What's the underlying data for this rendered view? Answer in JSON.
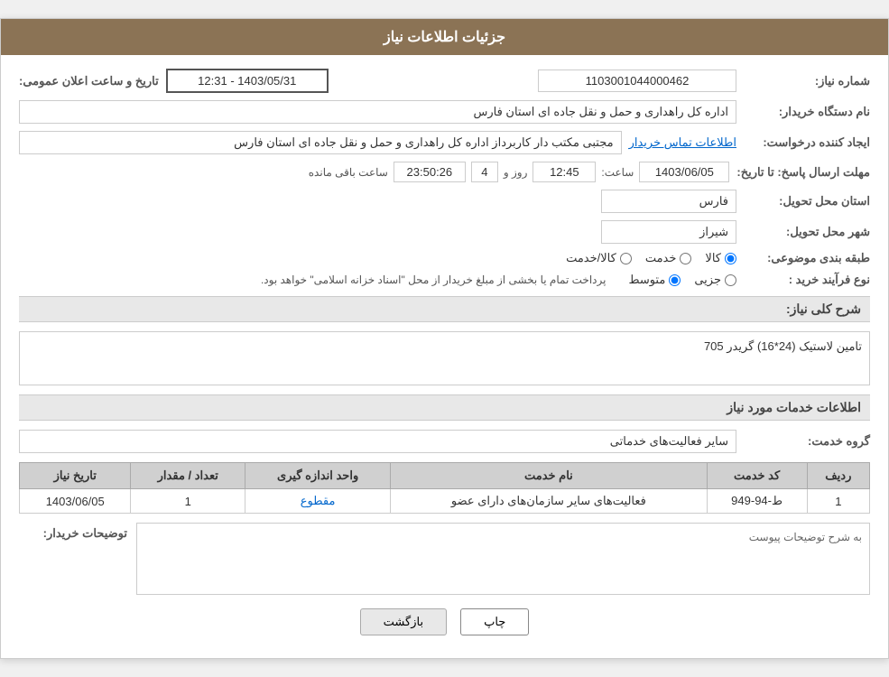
{
  "header": {
    "title": "جزئیات اطلاعات نیاز"
  },
  "form": {
    "need_number_label": "شماره نیاز:",
    "need_number_value": "1103001044000462",
    "purchaser_org_label": "نام دستگاه خریدار:",
    "purchaser_org_value": "اداره کل راهداری و حمل و نقل جاده ای استان فارس",
    "creator_label": "ایجاد کننده درخواست:",
    "creator_value": "مجتبی مکتب دار کاربرداز اداره کل راهداری و حمل و نقل جاده ای استان فارس",
    "contact_info_label": "اطلاعات تماس خریدار",
    "send_deadline_label": "مهلت ارسال پاسخ: تا تاریخ:",
    "send_deadline_date": "1403/06/05",
    "send_deadline_time_label": "ساعت:",
    "send_deadline_time": "12:45",
    "send_deadline_days_label": "روز و",
    "send_deadline_days": "4",
    "send_deadline_remaining_label": "ساعت باقی مانده",
    "send_deadline_remaining": "23:50:26",
    "province_label": "استان محل تحویل:",
    "province_value": "فارس",
    "city_label": "شهر محل تحویل:",
    "city_value": "شیراز",
    "category_label": "طبقه بندی موضوعی:",
    "category_options": [
      {
        "id": "kala",
        "label": "کالا"
      },
      {
        "id": "khadamat",
        "label": "خدمت"
      },
      {
        "id": "kala_khadamat",
        "label": "کالا/خدمت"
      }
    ],
    "category_selected": "kala",
    "purchase_type_label": "نوع فرآیند خرید :",
    "purchase_type_options": [
      {
        "id": "jozei",
        "label": "جزیی"
      },
      {
        "id": "motavaset",
        "label": "متوسط"
      }
    ],
    "purchase_type_selected": "motavaset",
    "purchase_type_note": "پرداخت تمام یا بخشی از مبلغ خریدار از محل \"اسناد خزانه اسلامی\" خواهد بود.",
    "announcement_date_label": "تاریخ و ساعت اعلان عمومی:",
    "announcement_date_value": "1403/05/31 - 12:31",
    "need_description_label": "شرح کلی نیاز:",
    "need_description_value": "تامین لاستیک (24*16) گریدر 705",
    "services_info_label": "اطلاعات خدمات مورد نیاز",
    "service_group_label": "گروه خدمت:",
    "service_group_value": "سایر فعالیت‌های خدماتی",
    "table": {
      "columns": [
        "ردیف",
        "کد خدمت",
        "نام خدمت",
        "واحد اندازه گیری",
        "تعداد / مقدار",
        "تاریخ نیاز"
      ],
      "rows": [
        {
          "row_num": "1",
          "service_code": "ط-94-949",
          "service_name": "فعالیت‌های سایر سازمان‌های دارای عضو",
          "unit": "مقطوع",
          "quantity": "1",
          "need_date": "1403/06/05"
        }
      ]
    },
    "buyer_description_label": "توضیحات خریدار:",
    "buyer_description_placeholder": "به شرح توضیحات پیوست"
  },
  "buttons": {
    "print_label": "چاپ",
    "back_label": "بازگشت"
  }
}
